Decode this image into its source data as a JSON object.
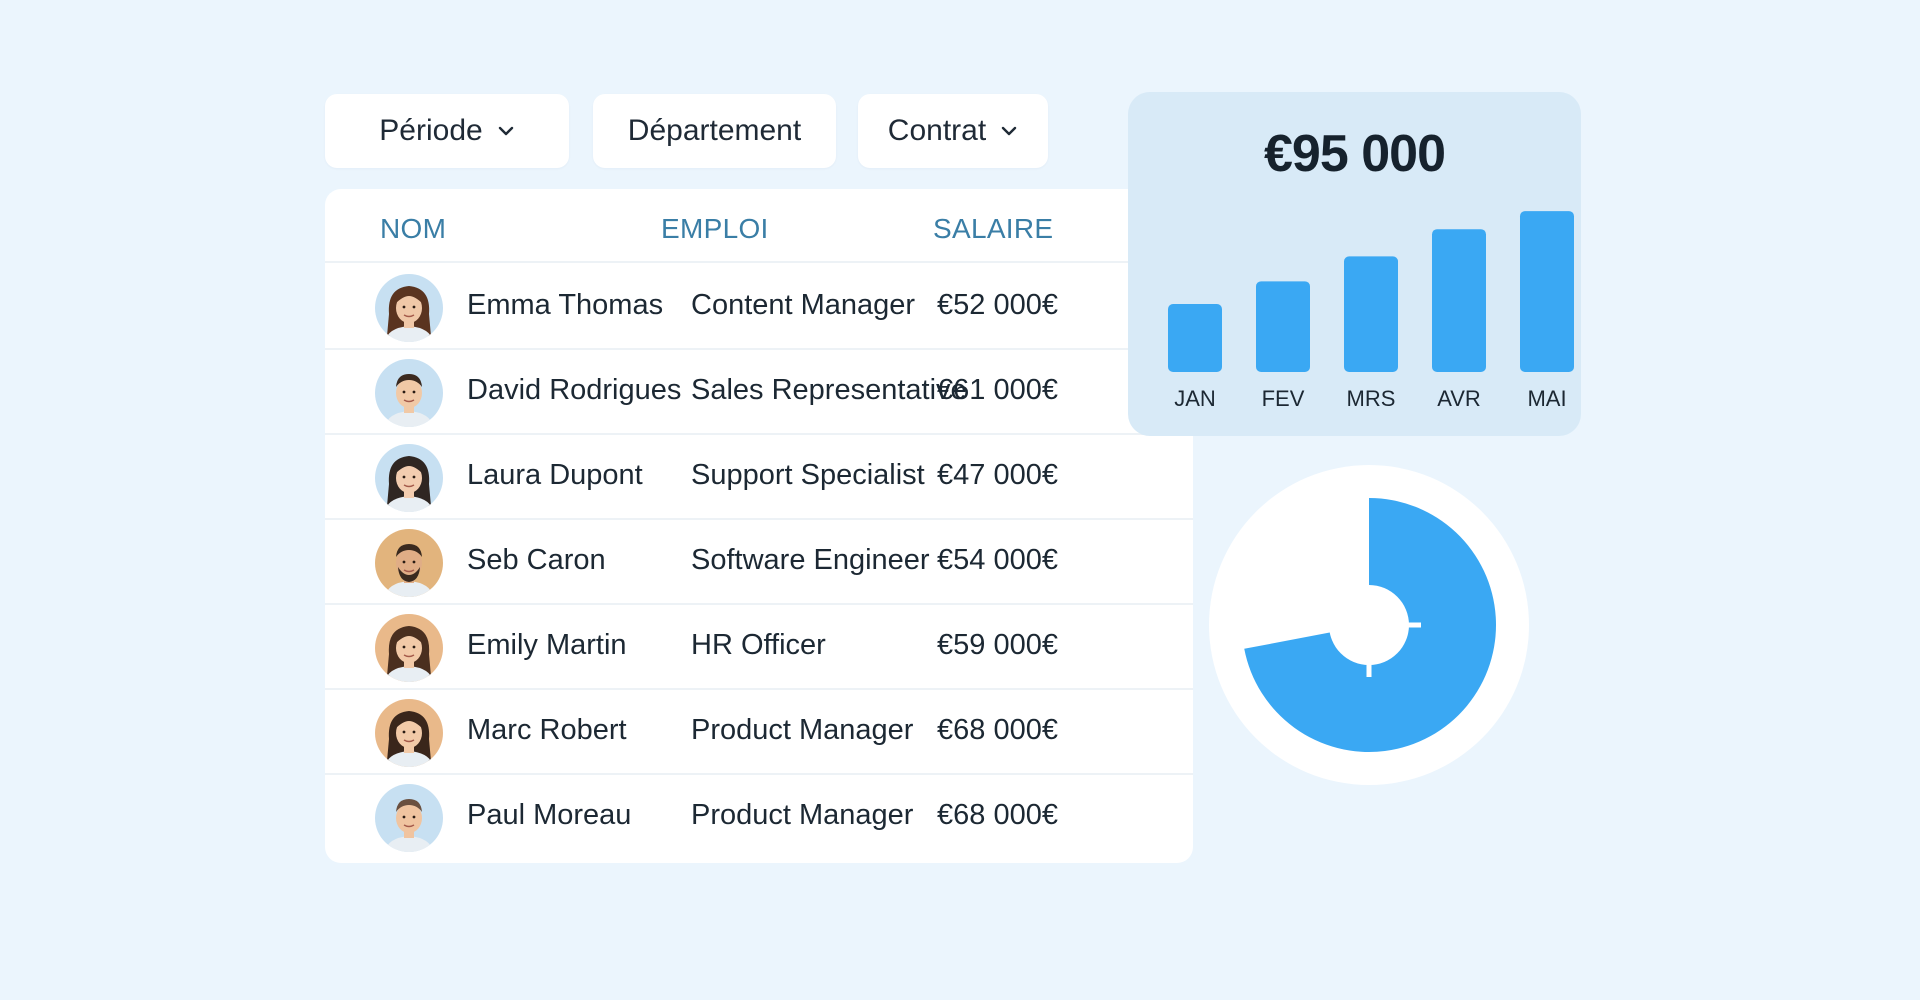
{
  "filters": {
    "periode": "Période",
    "departement": "Département",
    "contrat": "Contrat"
  },
  "table": {
    "headers": {
      "nom": "NOM",
      "emploi": "EMPLOI",
      "salaire": "SALAIRE"
    },
    "rows": [
      {
        "name": "Emma Thomas",
        "job": "Content Manager",
        "salary": "€52 000€",
        "avatar": "woman-1"
      },
      {
        "name": "David Rodrigues",
        "job": "Sales Representative",
        "salary": "€61 000€",
        "avatar": "man-1"
      },
      {
        "name": "Laura Dupont",
        "job": "Support Specialist",
        "salary": "€47 000€",
        "avatar": "woman-2"
      },
      {
        "name": "Seb Caron",
        "job": "Software Engineer",
        "salary": "€54 000€",
        "avatar": "man-beard"
      },
      {
        "name": "Emily Martin",
        "job": "HR Officer",
        "salary": "€59 000€",
        "avatar": "woman-3"
      },
      {
        "name": "Marc Robert",
        "job": "Product Manager",
        "salary": "€68 000€",
        "avatar": "woman-4"
      },
      {
        "name": "Paul Moreau",
        "job": "Product Manager",
        "salary": "€68 000€",
        "avatar": "man-2"
      }
    ]
  },
  "summary": {
    "total": "€95 000"
  },
  "colors": {
    "accent": "#3aa8f3",
    "header_text": "#3a7ea6",
    "background": "#ebf5fd",
    "card_tint": "#d8eaf7"
  },
  "chart_data": [
    {
      "type": "bar",
      "categories": [
        "JAN",
        "FEV",
        "MRS",
        "AVR",
        "MAI"
      ],
      "values": [
        30,
        40,
        51,
        63,
        71
      ],
      "title": "€95 000",
      "xlabel": "",
      "ylabel": "",
      "ylim": [
        0,
        75
      ],
      "grid": false
    },
    {
      "type": "pie",
      "values": [
        72,
        28
      ],
      "title": "",
      "grid": false
    }
  ]
}
